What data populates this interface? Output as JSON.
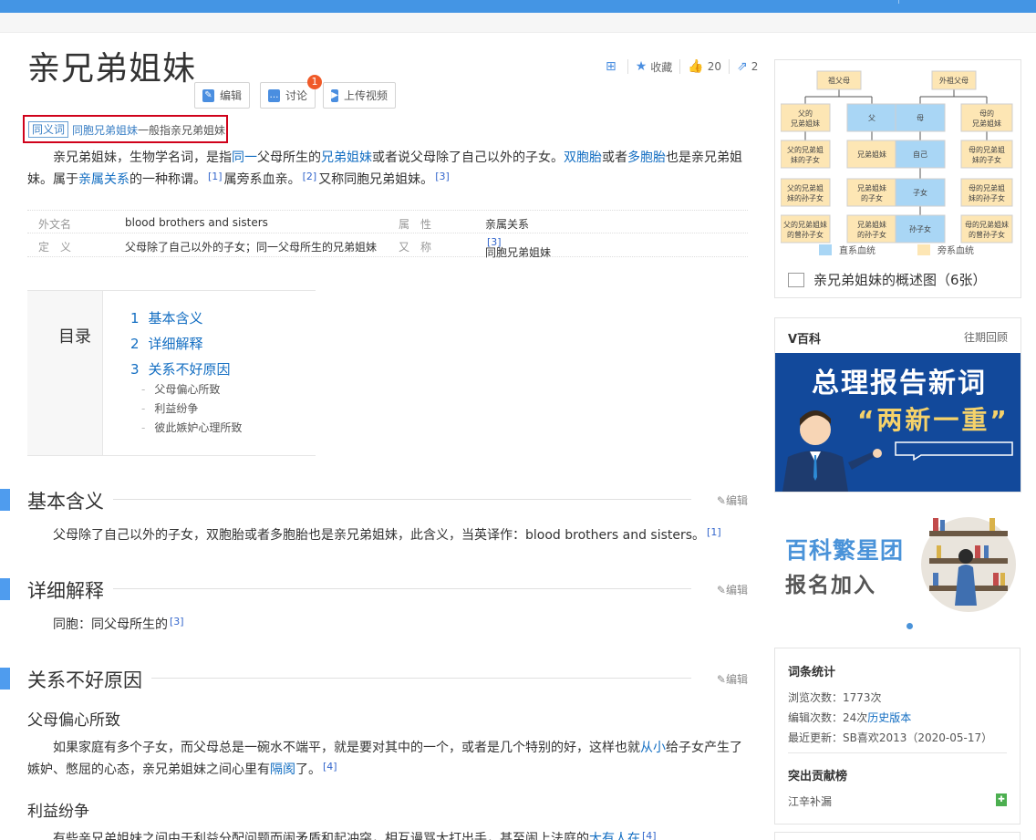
{
  "page": {
    "title": "亲兄弟姐妹",
    "buttons": {
      "edit": "编辑",
      "discuss": "讨论",
      "upload_video": "上传视频"
    },
    "discuss_badge": "1",
    "actions": {
      "favorite": "收藏",
      "likes": "20",
      "shares": "2"
    }
  },
  "synonym": {
    "tag": "同义词",
    "link": "同胞兄弟姐妹",
    "text": "一般指亲兄弟姐妹"
  },
  "summary": {
    "s1": "亲兄弟姐妹，生物学名词，是指",
    "l1": "同一",
    "s2": "父母所生的",
    "l2": "兄弟姐妹",
    "s3": "或者说父母除了自己以外的子女。",
    "l3": "双胞胎",
    "s4": "或者",
    "l4": "多胞胎",
    "s5": "也是亲兄弟姐妹。属于",
    "l5": "亲属关系",
    "s6": "的一种称谓。",
    "r1": "[1]",
    "s7": "属旁系血亲。",
    "r2": "[2]",
    "s8": "又称同胞兄弟姐妹。",
    "r3": "[3]"
  },
  "basic_info": {
    "k1": "外文名",
    "v1": "blood brothers and sisters",
    "k2": "属　性",
    "v2": "亲属关系",
    "k3": "定　义",
    "v3": "父母除了自己以外的子女；同一父母所生的兄弟姐妹",
    "k4": "又　称",
    "v4": "同胞兄弟姐妹",
    "v4ref": "[3]"
  },
  "toc": {
    "label": "目录",
    "items": [
      {
        "num": "1",
        "text": "基本含义"
      },
      {
        "num": "2",
        "text": "详细解释"
      },
      {
        "num": "3",
        "text": "关系不好原因"
      }
    ],
    "sub": [
      "父母偏心所致",
      "利益纷争",
      "彼此嫉妒心理所致"
    ]
  },
  "sections": {
    "edit_label": "编辑",
    "s1_title": "基本含义",
    "s1_text": "父母除了自己以外的子女，双胞胎或者多胞胎也是亲兄弟姐妹，此含义，当英译作：blood brothers and sisters。",
    "s1_ref": "[1]",
    "s2_title": "详细解释",
    "s2_text": "同胞：同父母所生的",
    "s2_ref": "[3]",
    "s3_title": "关系不好原因",
    "s3a_title": "父母偏心所致",
    "s3a_text1": "如果家庭有多个子女，而父母总是一碗水不端平，就是要对其中的一个，或者是几个特别的好，这样也就",
    "s3a_link1": "从小",
    "s3a_text2": "给子女产生了嫉妒、憋屈的心态，亲兄弟姐妹之间心里有",
    "s3a_link2": "隔阂",
    "s3a_text3": "了。",
    "s3a_ref": "[4]",
    "s3b_title": "利益纷争",
    "s3b_text": "有些亲兄弟姐妹之间由于利益分配问题而闹矛盾和起冲突，相互谩骂大打出手，甚至闹上法庭的",
    "s3b_link": "大有人在",
    "s3b_ref": "[4]"
  },
  "sidebar": {
    "diagram": {
      "cells": [
        "祖父母",
        "外祖父母",
        "父的兄弟姐妹",
        "父",
        "母",
        "母的兄弟姐妹",
        "父的兄弟姐妹的子女",
        "兄弟姐妹",
        "自己",
        "母的兄弟姐妹的子女",
        "父的兄弟姐妹的孙子女",
        "兄弟姐妹的子女",
        "子女",
        "母的兄弟姐妹的孙子女",
        "父的兄弟姐妹的曾孙子女",
        "兄弟姐妹的孙子女",
        "孙子女",
        "母的兄弟姐妹的曾孙子女"
      ],
      "legend_direct": "直系血统",
      "legend_collateral": "旁系血统"
    },
    "image_caption": "亲兄弟姐妹的概述图（6张）",
    "vbaike": {
      "title": "V百科",
      "more": "往期回顾",
      "banner_line1": "总理报告新词",
      "banner_line2": "“两新一重”"
    },
    "promo": {
      "line1": "百科繁星团",
      "line2": "报名加入"
    },
    "stats": {
      "title": "词条统计",
      "views": "浏览次数：1773次",
      "edits_prefix": "编辑次数：24次",
      "edits_link": "历史版本",
      "updated": "最近更新：SB喜欢2013（2020-05-17）",
      "contrib_title": "突出贡献榜",
      "contrib_user": "江辛补漏"
    }
  },
  "colors": {
    "accent": "#4495e4",
    "link": "#136ec2",
    "highlight_box": "#d0021b",
    "direct_line": "#a9d6f5",
    "collateral_line": "#fde6b4"
  }
}
